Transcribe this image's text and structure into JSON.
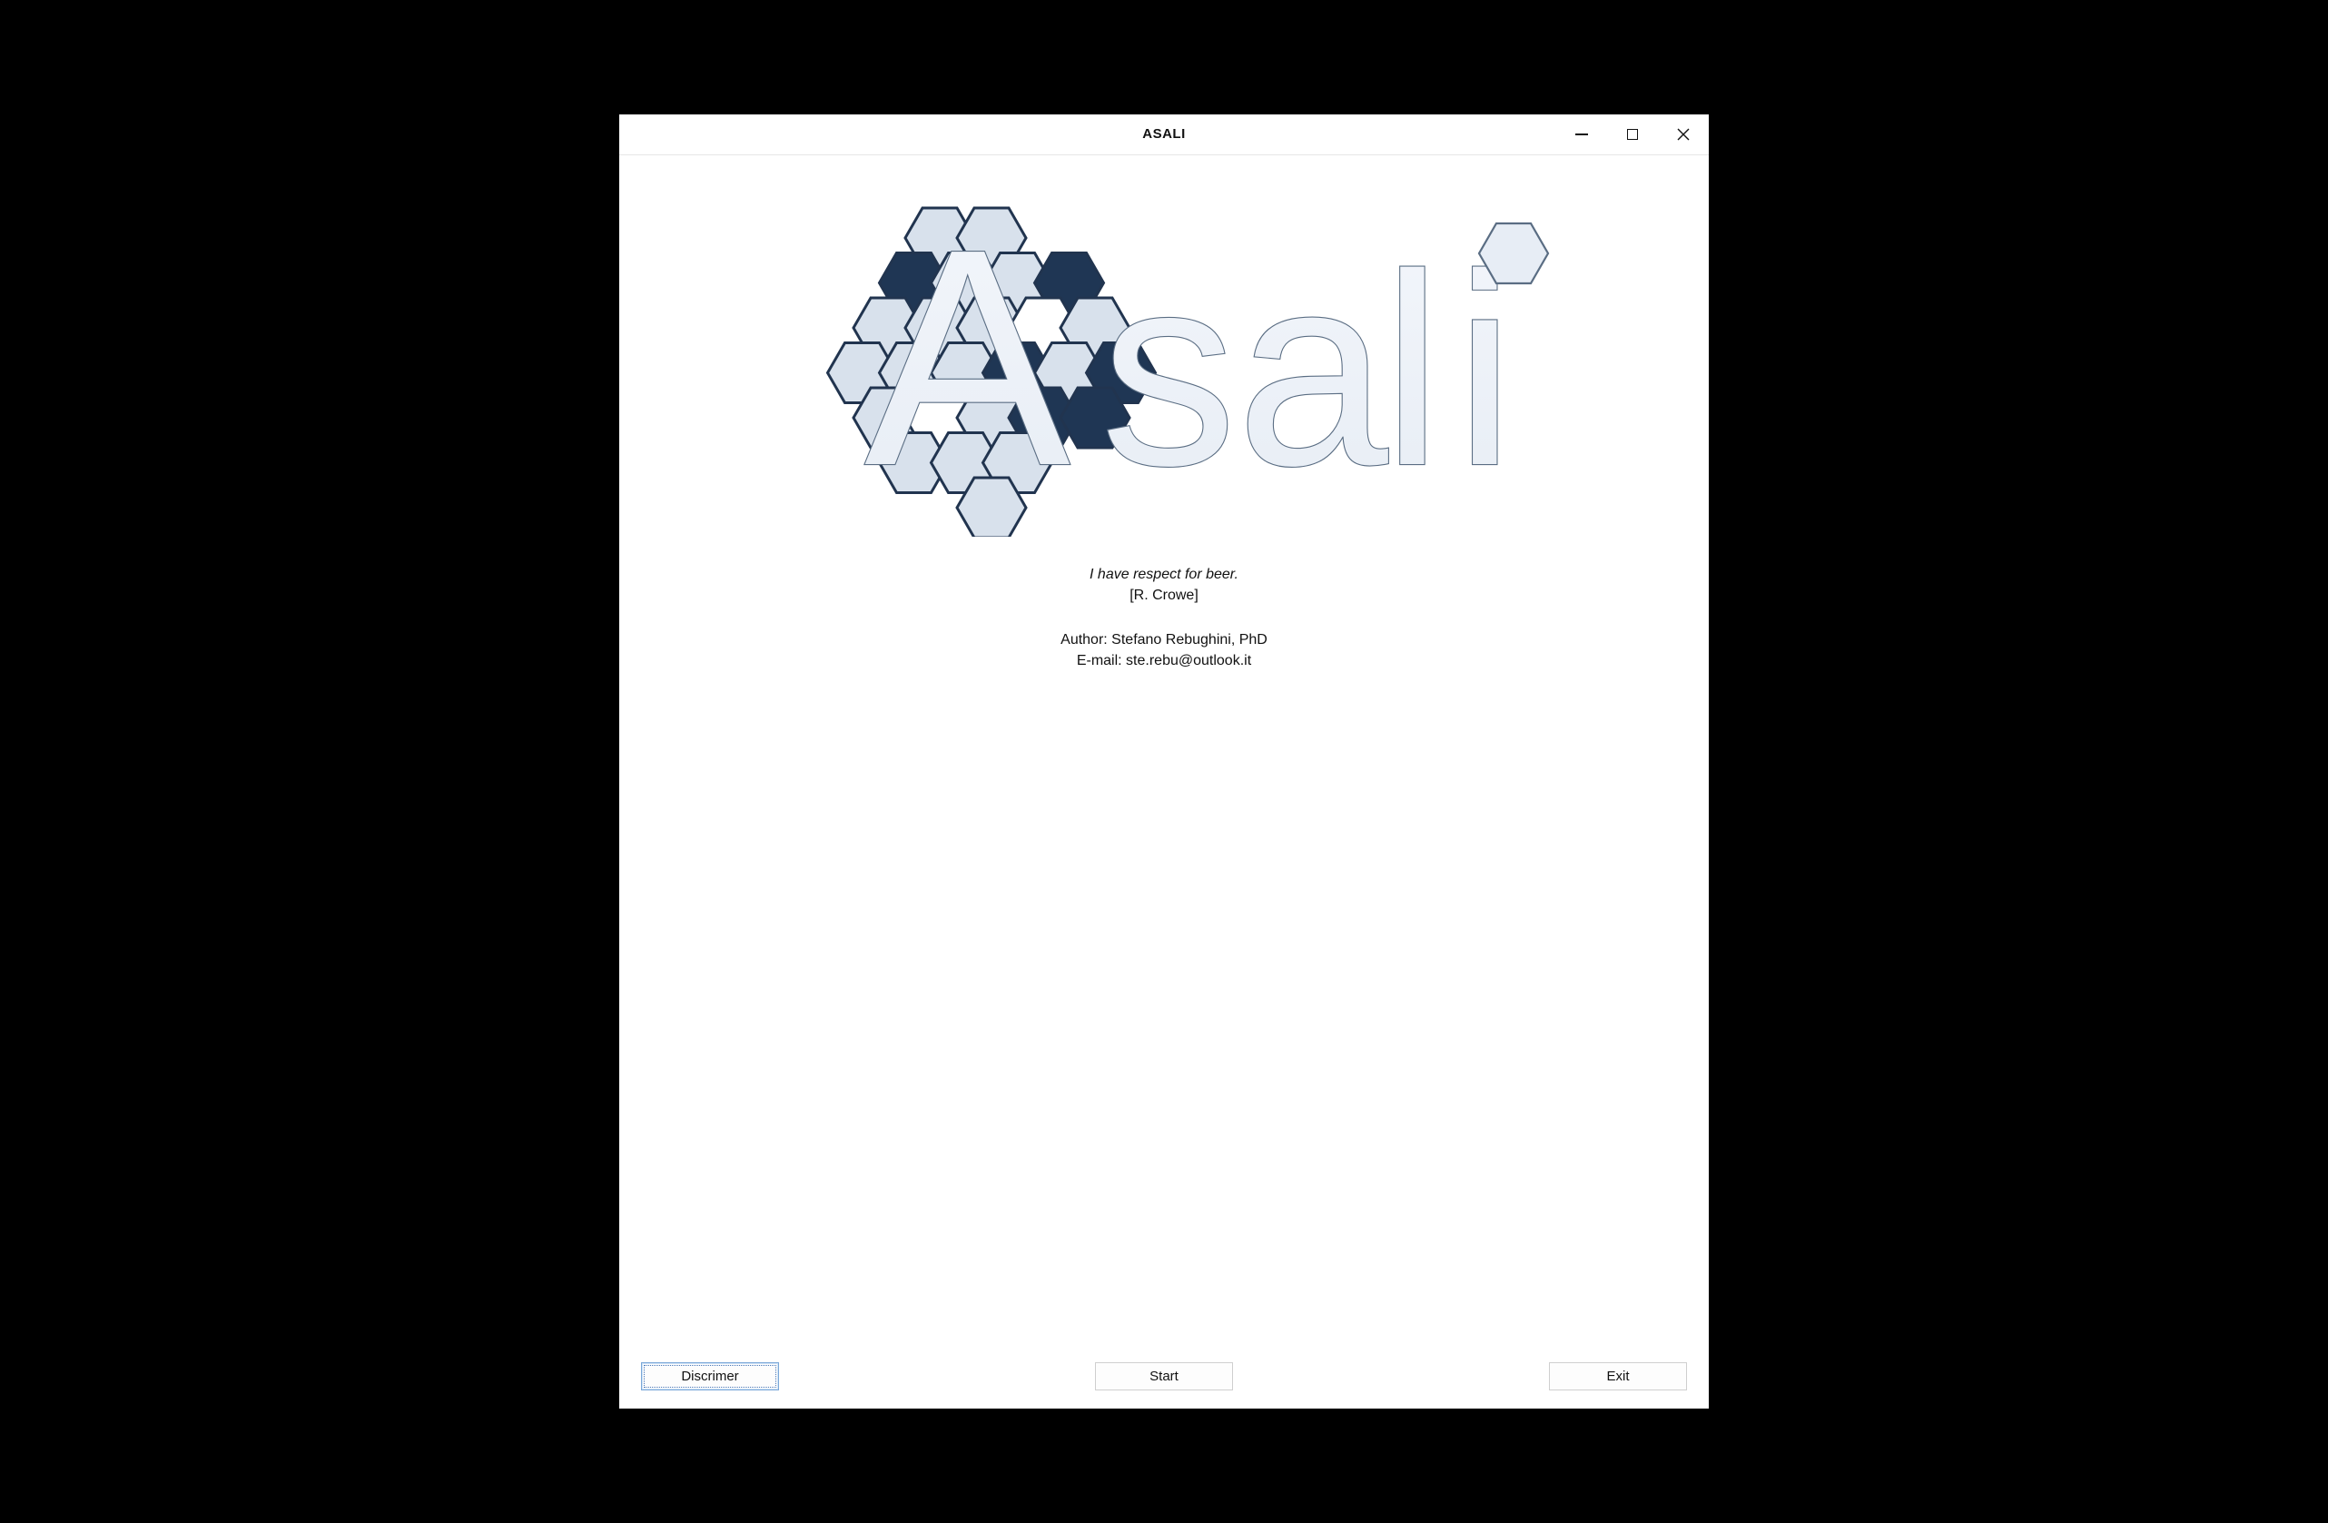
{
  "window": {
    "title": "ASALI"
  },
  "logo": {
    "name": "asali-logo"
  },
  "info": {
    "quote": "I have respect for beer.",
    "attribution": "[R. Crowe]",
    "author_line": "Author: Stefano Rebughini, PhD",
    "email_line": "E-mail: ste.rebu@outlook.it"
  },
  "buttons": {
    "discrimer": "Discrimer",
    "start": "Start",
    "exit": "Exit"
  }
}
